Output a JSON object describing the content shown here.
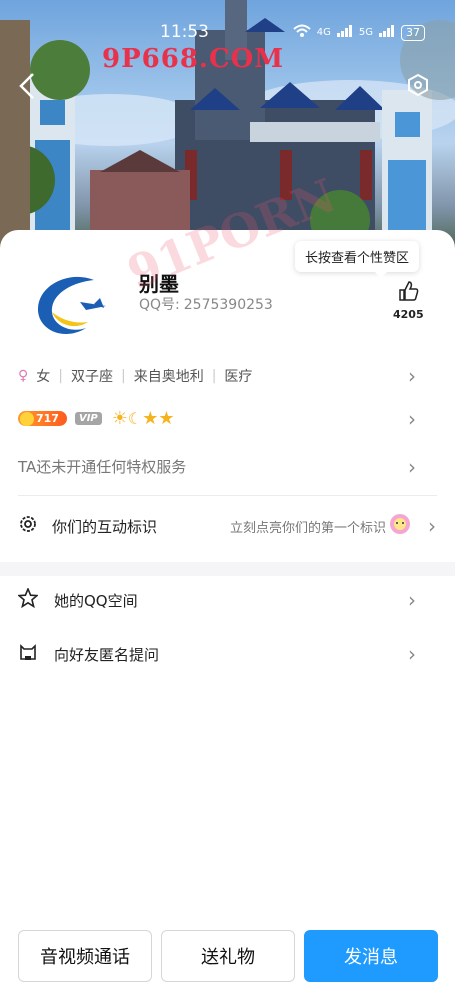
{
  "status_bar": {
    "time": "11:53",
    "network_a": "4G",
    "network_b": "5G",
    "battery": "37"
  },
  "watermark": {
    "top": "9P668.COM",
    "middle": "91PORN"
  },
  "profile": {
    "nickname": "别墨",
    "qq_label": "QQ号:",
    "qq_number": "2575390253",
    "like_tooltip": "长按查看个性赞区",
    "like_count": "4205"
  },
  "info_tags": [
    "女",
    "双子座",
    "来自奥地利",
    "医疗"
  ],
  "level": {
    "value": "717",
    "vip_label": "VIP"
  },
  "privilege_text": "TA还未开通任何特权服务",
  "interaction": {
    "label": "你们的互动标识",
    "hint": "立刻点亮你们的第一个标识"
  },
  "menu": {
    "qzone": "她的QQ空间",
    "anon_question": "向好友匿名提问"
  },
  "actions": {
    "call": "音视频通话",
    "gift": "送礼物",
    "message": "发消息"
  }
}
